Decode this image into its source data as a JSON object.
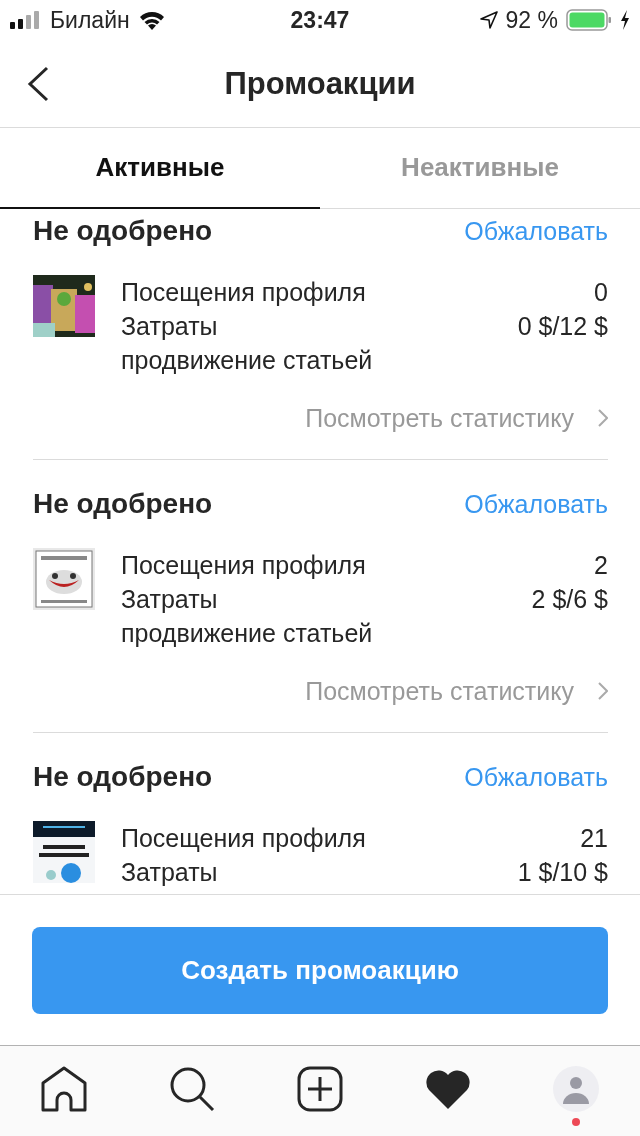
{
  "status_bar": {
    "carrier": "Билайн",
    "time": "23:47",
    "battery": "92 %",
    "charging": true
  },
  "header": {
    "back": true,
    "title": "Промоакции"
  },
  "tabs": [
    {
      "label": "Активные",
      "selected": true
    },
    {
      "label": "Неактивные",
      "selected": false
    }
  ],
  "promotions": [
    {
      "status": "Не одобрено",
      "action": "Обжаловать",
      "thumbnail": {
        "kind": "picture"
      },
      "lines": [
        {
          "label": "Посещения профиля",
          "value": "0"
        },
        {
          "label": "Затраты",
          "value": "0 $/12 $"
        },
        {
          "label": "продвижение статьей"
        }
      ],
      "link": "Посмотреть статистику"
    },
    {
      "status": "Не одобрено",
      "action": "Обжаловать",
      "thumbnail": {
        "kind": "picture"
      },
      "lines": [
        {
          "label": "Посещения профиля",
          "value": "2"
        },
        {
          "label": "Затраты",
          "value": "2 $/6 $"
        },
        {
          "label": "продвижение статьей"
        }
      ],
      "link": "Посмотреть статистику"
    },
    {
      "status": "Не одобрено",
      "action": "Обжаловать",
      "thumbnail": {
        "kind": "picture"
      },
      "lines": [
        {
          "label": "Посещения профиля",
          "value": "21"
        },
        {
          "label": "Затраты",
          "value": "1 $/10 $"
        }
      ]
    }
  ],
  "create_button": "Создать промоакцию",
  "tab_bar": [
    {
      "kind": "home",
      "badge": false
    },
    {
      "kind": "search",
      "badge": false
    },
    {
      "kind": "add",
      "badge": false
    },
    {
      "kind": "heart",
      "badge": false
    },
    {
      "kind": "profile",
      "badge": true
    }
  ]
}
